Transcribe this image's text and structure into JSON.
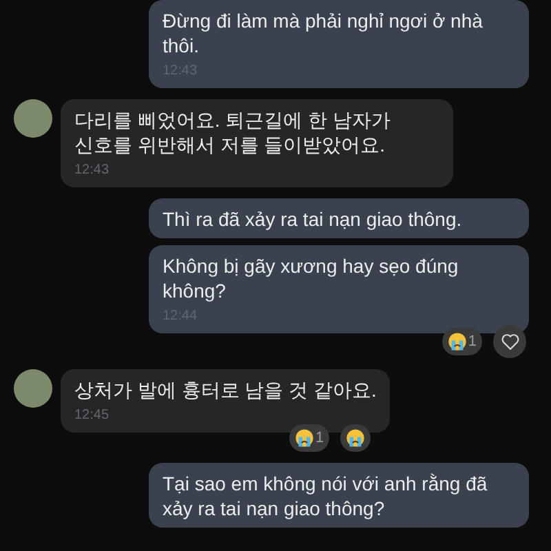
{
  "messages": [
    {
      "kind": "outgoing",
      "text": "Đừng đi làm mà phải nghỉ ngơi ở nhà thôi.",
      "time": "12:43"
    },
    {
      "kind": "incoming",
      "text": "다리를 삐었어요. 퇴근길에 한 남자가 신호를 위반해서 저를 들이받았어요.",
      "time": "12:43"
    },
    {
      "kind": "outgoing",
      "text": "Thì ra đã xảy ra tai nạn giao thông."
    },
    {
      "kind": "outgoing",
      "text": "Không bị gãy xương hay sẹo đúng không?",
      "time": "12:44",
      "reactions": [
        {
          "kind": "crying",
          "count": "1"
        },
        {
          "kind": "heart"
        }
      ]
    },
    {
      "kind": "incoming",
      "text": "상처가 발에 흉터로 남을 것 같아요.",
      "time": "12:45",
      "reactions": [
        {
          "kind": "crying",
          "count": "1"
        },
        {
          "kind": "crying"
        }
      ]
    },
    {
      "kind": "outgoing",
      "text": "Tại sao em không nói với anh rằng đã xảy ra tai nạn giao thông?"
    }
  ]
}
